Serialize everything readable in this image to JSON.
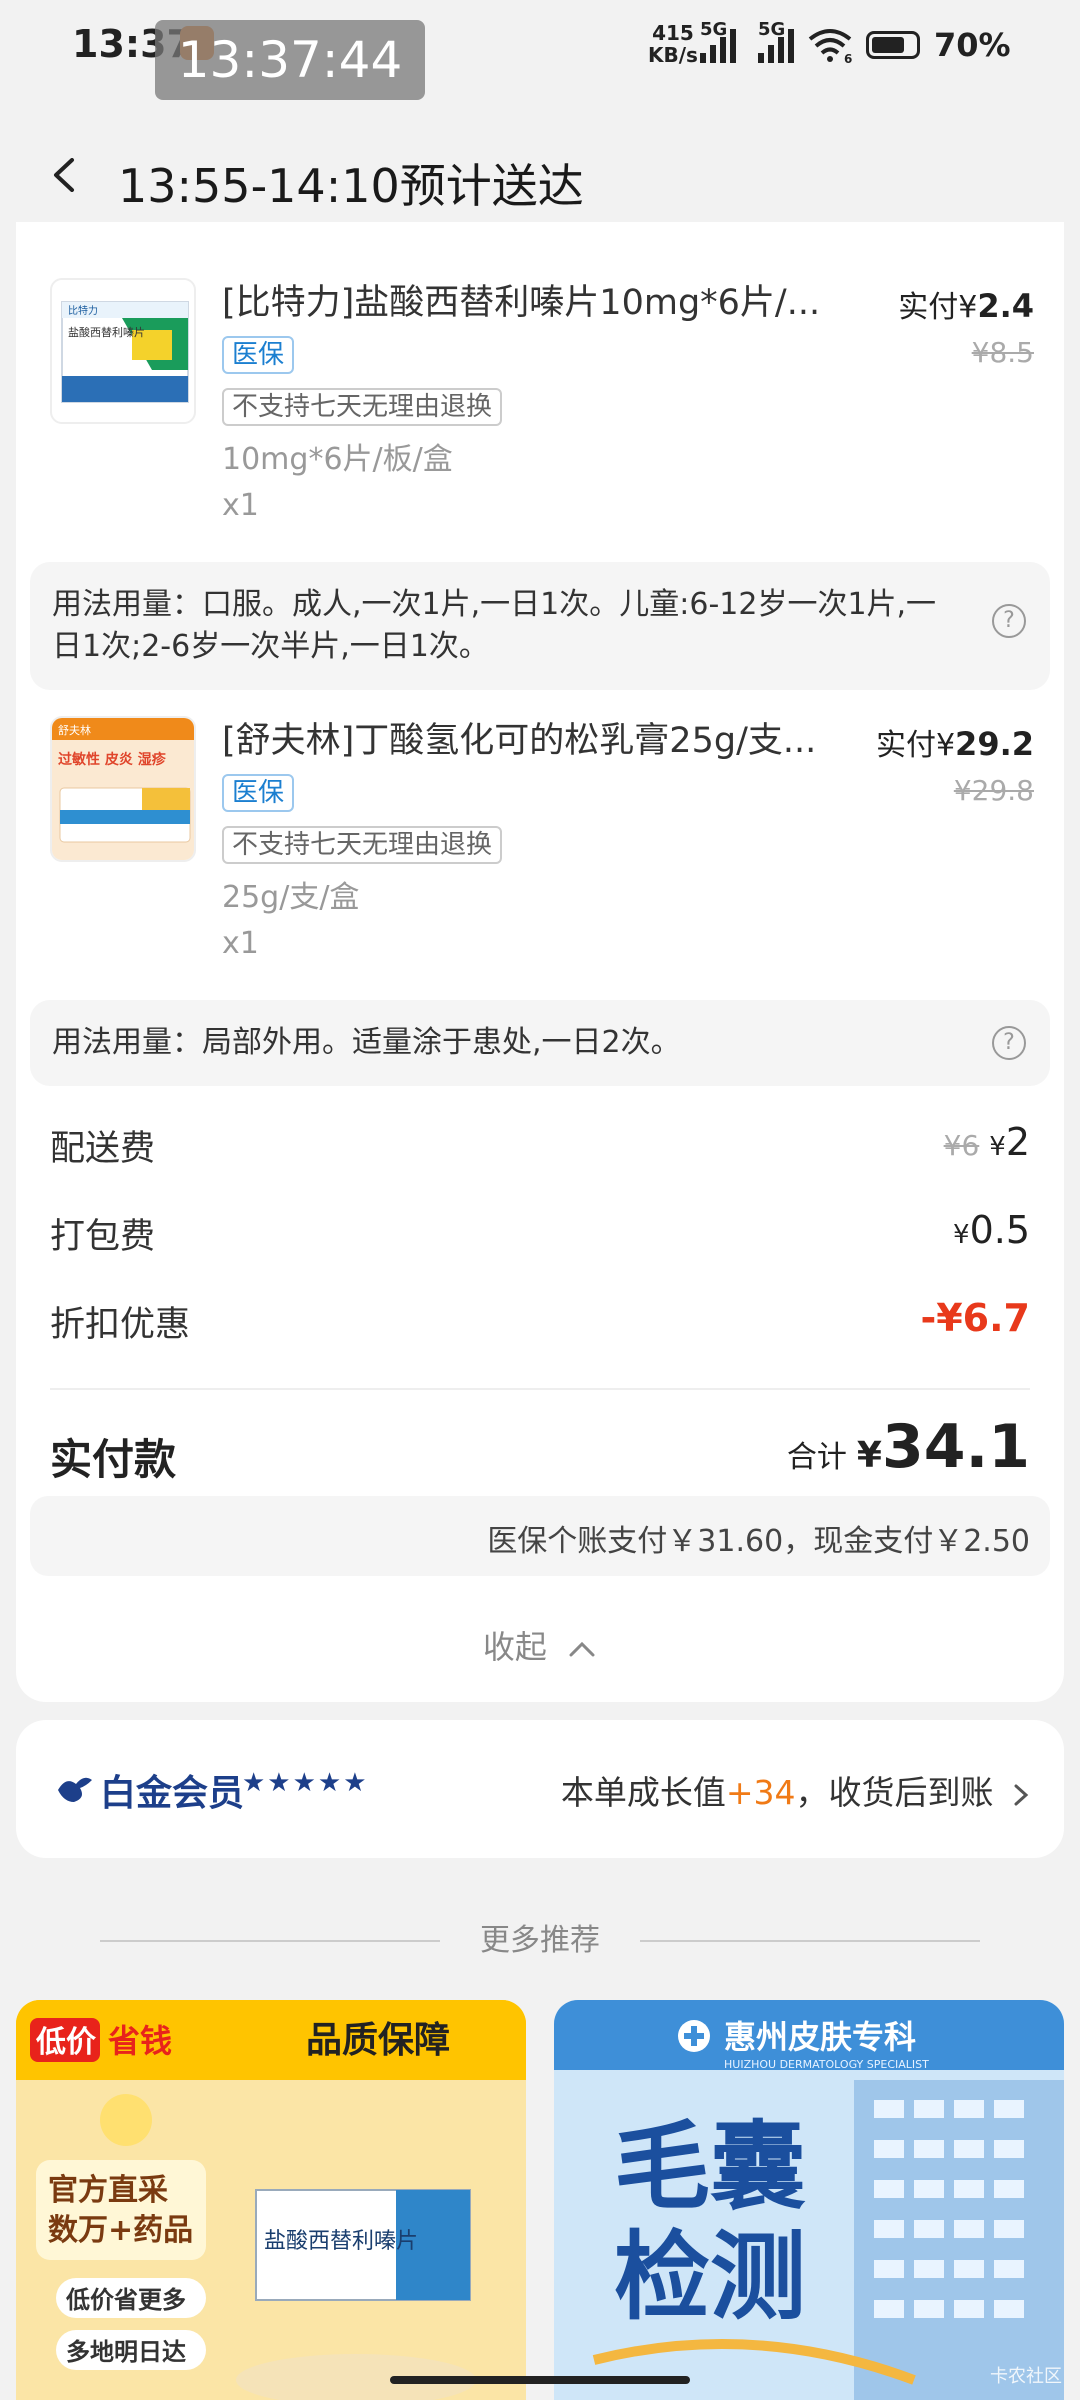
{
  "status_bar": {
    "time": "13:37",
    "overlay_time": "13:37:44",
    "net_speed_value": "415",
    "net_speed_unit": "KB/s",
    "sig1": "5G",
    "sig2": "5G",
    "wifi_num": "6",
    "battery": "70%"
  },
  "header": {
    "title": "13:55-14:10预计送达"
  },
  "items": [
    {
      "name": "[比特力]盐酸西替利嗪片10mg*6片/...",
      "tag_insurance": "医保",
      "tag_return": "不支持七天无理由退换",
      "spec": "10mg*6片/板/盒",
      "qty": "x1",
      "paid_label": "实付¥",
      "paid_value": "2.4",
      "orig_price": "¥8.5",
      "usage": "用法用量：口服。成人,一次1片,一日1次。儿童:6-12岁一次1片,一日1次;2-6岁一次半片,一日1次。",
      "box_text": "盐酸西替利嗪片",
      "box_brand": "比特力"
    },
    {
      "name": "[舒夫林]丁酸氢化可的松乳膏25g/支...",
      "tag_insurance": "医保",
      "tag_return": "不支持七天无理由退换",
      "spec": "25g/支/盒",
      "qty": "x1",
      "paid_label": "实付¥",
      "paid_value": "29.2",
      "orig_price": "¥29.8",
      "usage": "用法用量：局部外用。适量涂于患处,一日2次。",
      "box_text": "过敏性 皮炎 湿疹",
      "box_brand": "舒夫林"
    }
  ],
  "fees": {
    "delivery_label": "配送费",
    "delivery_orig": "¥6",
    "delivery_value": "2",
    "packing_label": "打包费",
    "packing_value": "0.5",
    "discount_label": "折扣优惠",
    "discount_value": "-¥6.7",
    "currency": "¥"
  },
  "payment": {
    "label": "实付款",
    "total_prefix": "合计",
    "currency": "¥",
    "total": "34.1",
    "insurance_split": "医保个账支付￥31.60，现金支付￥2.50",
    "collapse": "收起"
  },
  "membership": {
    "name": "白金会员",
    "stars": "★★★★★",
    "growth_prefix": "本单成长值",
    "growth_value": "+34",
    "growth_suffix": "，收货后到账"
  },
  "recommend": {
    "title": "更多推荐",
    "left": {
      "badge": "低价",
      "badge2": "省钱",
      "headline": "品质保障",
      "line1": "官方直采",
      "line2": "数万+药品",
      "pill1": "低价省更多",
      "pill2": "多地明日达",
      "box": "盐酸西替利嗪片"
    },
    "right": {
      "banner": "惠州皮肤专科",
      "subtitle": "HUIZHOU DERMATOLOGY SPECIALIST",
      "big1": "毛囊",
      "big2": "检测"
    }
  },
  "watermark": "卡农社区",
  "colors": {
    "accent_red": "#e8391b",
    "insurance_blue": "#1b7fd0",
    "member_blue": "#1d3f8a",
    "growth_orange": "#f07a16"
  }
}
